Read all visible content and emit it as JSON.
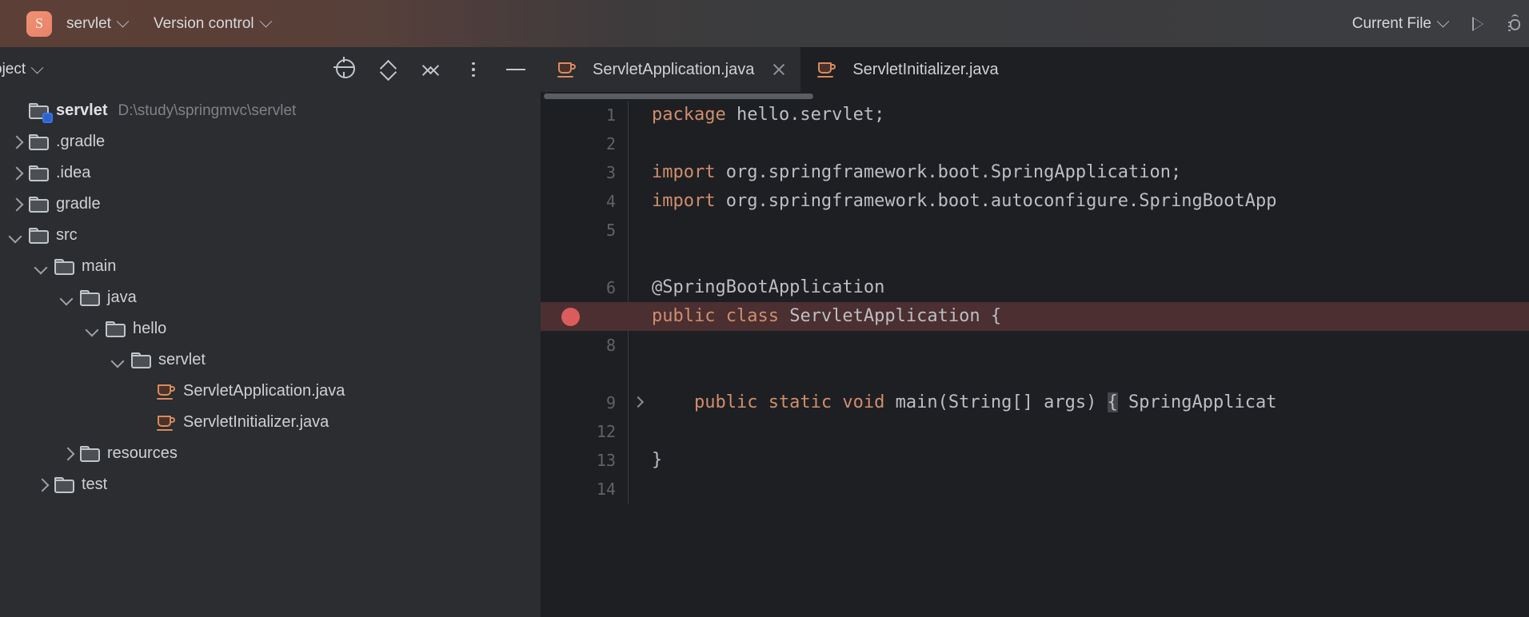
{
  "titlebar": {
    "project_badge": "S",
    "project_name": "servlet",
    "version_control": "Version control",
    "run_config": "Current File",
    "run_icon": "run-triangle-icon",
    "debug_icon": "debug-bug-icon"
  },
  "project_panel": {
    "title": "oject",
    "tools": [
      {
        "name": "select-opened-file",
        "icon": "crosshair-icon"
      },
      {
        "name": "expand-collapse",
        "icon": "up-down-chevron-icon"
      },
      {
        "name": "collapse-all",
        "icon": "collapse-all-icon"
      },
      {
        "name": "more-options",
        "icon": "vertical-dots-icon"
      },
      {
        "name": "hide-panel",
        "icon": "minus-icon"
      }
    ],
    "tree": [
      {
        "label": "servlet",
        "path": "D:\\study\\springmvc\\servlet",
        "indent": 0,
        "arrow": "none",
        "icon": "module-folder-icon",
        "root": true
      },
      {
        "label": ".gradle",
        "path": "",
        "indent": 0,
        "arrow": "closed",
        "icon": "folder-icon",
        "root": false
      },
      {
        "label": ".idea",
        "path": "",
        "indent": 0,
        "arrow": "closed",
        "icon": "folder-icon",
        "root": false
      },
      {
        "label": "gradle",
        "path": "",
        "indent": 0,
        "arrow": "closed",
        "icon": "folder-icon",
        "root": false
      },
      {
        "label": "src",
        "path": "",
        "indent": 0,
        "arrow": "open",
        "icon": "folder-icon",
        "root": false
      },
      {
        "label": "main",
        "path": "",
        "indent": 1,
        "arrow": "open",
        "icon": "folder-icon",
        "root": false
      },
      {
        "label": "java",
        "path": "",
        "indent": 2,
        "arrow": "open",
        "icon": "folder-icon",
        "root": false
      },
      {
        "label": "hello",
        "path": "",
        "indent": 3,
        "arrow": "open",
        "icon": "folder-icon",
        "root": false
      },
      {
        "label": "servlet",
        "path": "",
        "indent": 4,
        "arrow": "open",
        "icon": "folder-icon",
        "root": false
      },
      {
        "label": "ServletApplication.java",
        "path": "",
        "indent": 5,
        "arrow": "none",
        "icon": "java-class-icon",
        "root": false
      },
      {
        "label": "ServletInitializer.java",
        "path": "",
        "indent": 5,
        "arrow": "none",
        "icon": "java-class-icon",
        "root": false
      },
      {
        "label": "resources",
        "path": "",
        "indent": 2,
        "arrow": "closed",
        "icon": "folder-icon",
        "root": false
      },
      {
        "label": "test",
        "path": "",
        "indent": 1,
        "arrow": "closed",
        "icon": "folder-icon",
        "root": false
      }
    ]
  },
  "editor": {
    "tabs": [
      {
        "label": "ServletApplication.java",
        "icon": "java-class-icon",
        "active": true,
        "closable": true
      },
      {
        "label": "ServletInitializer.java",
        "icon": "java-class-icon",
        "active": false,
        "closable": false
      }
    ],
    "lines": [
      {
        "no": "1",
        "fold": false,
        "breakpoint": false,
        "highlight": false,
        "segments": [
          {
            "t": "package",
            "c": "kw"
          },
          {
            "t": " hello.servlet;",
            "c": ""
          }
        ]
      },
      {
        "no": "2",
        "fold": false,
        "breakpoint": false,
        "highlight": false,
        "segments": []
      },
      {
        "no": "3",
        "fold": false,
        "breakpoint": false,
        "highlight": false,
        "segments": [
          {
            "t": "import",
            "c": "kw"
          },
          {
            "t": " org.springframework.boot.SpringApplication;",
            "c": ""
          }
        ]
      },
      {
        "no": "4",
        "fold": false,
        "breakpoint": false,
        "highlight": false,
        "segments": [
          {
            "t": "import",
            "c": "kw"
          },
          {
            "t": " org.springframework.boot.autoconfigure.SpringBootApp",
            "c": ""
          }
        ]
      },
      {
        "no": "5",
        "fold": false,
        "breakpoint": false,
        "highlight": false,
        "segments": []
      },
      {
        "no": "",
        "fold": false,
        "breakpoint": false,
        "highlight": false,
        "segments": []
      },
      {
        "no": "6",
        "fold": false,
        "breakpoint": false,
        "highlight": false,
        "segments": [
          {
            "t": "@SpringBootApplication",
            "c": ""
          }
        ]
      },
      {
        "no": "",
        "fold": false,
        "breakpoint": true,
        "highlight": true,
        "segments": [
          {
            "t": "public class",
            "c": "kw"
          },
          {
            "t": " ServletApplication {",
            "c": ""
          }
        ]
      },
      {
        "no": "8",
        "fold": false,
        "breakpoint": false,
        "highlight": false,
        "segments": []
      },
      {
        "no": "",
        "fold": false,
        "breakpoint": false,
        "highlight": false,
        "segments": []
      },
      {
        "no": "9",
        "fold": true,
        "breakpoint": false,
        "highlight": false,
        "segments": [
          {
            "t": "    public static void",
            "c": "kw"
          },
          {
            "t": " main(String[] args) ",
            "c": ""
          },
          {
            "t": "{",
            "c": "brace"
          },
          {
            "t": " SpringApplicat",
            "c": ""
          }
        ]
      },
      {
        "no": "12",
        "fold": false,
        "breakpoint": false,
        "highlight": false,
        "segments": []
      },
      {
        "no": "13",
        "fold": false,
        "breakpoint": false,
        "highlight": false,
        "segments": [
          {
            "t": "}",
            "c": ""
          }
        ]
      },
      {
        "no": "14",
        "fold": false,
        "breakpoint": false,
        "highlight": false,
        "segments": []
      }
    ]
  },
  "colors": {
    "titlebar_accent": "#5c4038",
    "badge": "#e8836a",
    "panel_bg": "#2b2d30",
    "editor_bg": "#1e1f22",
    "keyword": "#cf8e6d",
    "text": "#bcbec4",
    "breakpoint": "#db5c5c",
    "breakpoint_line_bg": "#4b2f31",
    "module_badge": "#3574f0",
    "java_icon": "#d98a5f"
  }
}
